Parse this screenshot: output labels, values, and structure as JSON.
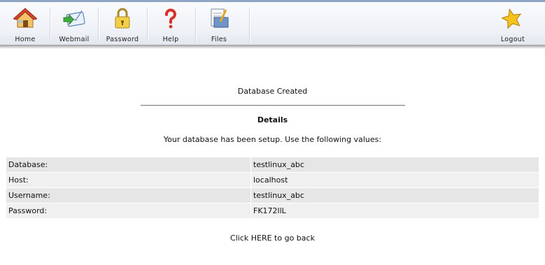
{
  "nav": {
    "home": "Home",
    "webmail": "Webmail",
    "password": "Password",
    "help": "Help",
    "files": "Files",
    "logout": "Logout"
  },
  "page": {
    "title": "Database Created",
    "details_heading": "Details",
    "intro": "Your database has been setup. Use the following values:",
    "back_link": "Click HERE to go back"
  },
  "values": [
    {
      "label": "Database:",
      "value": "testlinux_abc"
    },
    {
      "label": "Host:",
      "value": "localhost"
    },
    {
      "label": "Username:",
      "value": "testlinux_abc"
    },
    {
      "label": "Password:",
      "value": "FK172llL"
    }
  ],
  "colors": {
    "topbar_border": "#8fa6c4",
    "row_dark": "#e6e6e6",
    "row_light": "#f0f0f0"
  }
}
